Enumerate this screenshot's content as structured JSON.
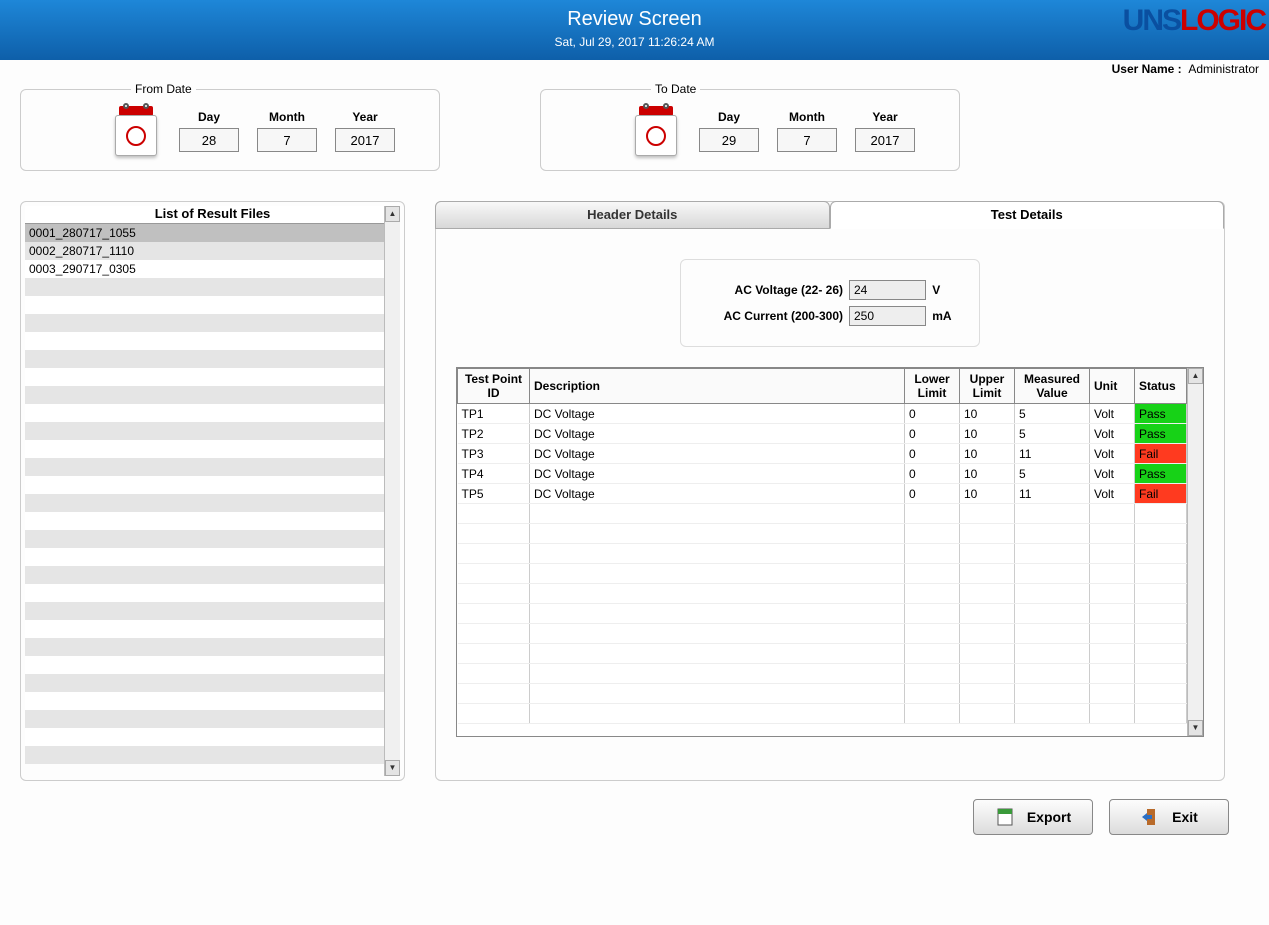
{
  "header": {
    "title": "Review Screen",
    "timestamp": "Sat, Jul 29, 2017 11:26:24 AM",
    "logo_text_blue": "UNS",
    "logo_text_red": "LOGIC"
  },
  "user_bar": {
    "label": "User Name :",
    "user_name": "Administrator"
  },
  "from_date": {
    "legend": "From Date",
    "day_label": "Day",
    "month_label": "Month",
    "year_label": "Year",
    "day": "28",
    "month": "7",
    "year": "2017"
  },
  "to_date": {
    "legend": "To Date",
    "day_label": "Day",
    "month_label": "Month",
    "year_label": "Year",
    "day": "29",
    "month": "7",
    "year": "2017"
  },
  "file_list": {
    "title": "List of Result Files",
    "items": [
      "0001_280717_1055",
      "0002_280717_1110",
      "0003_290717_0305"
    ],
    "selected_index": 0
  },
  "tabs": {
    "header_details": "Header Details",
    "test_details": "Test Details",
    "active": "test_details"
  },
  "ac": {
    "voltage_label": "AC Voltage (22- 26)",
    "voltage_value": "24",
    "voltage_unit": "V",
    "current_label": "AC Current (200-300)",
    "current_value": "250",
    "current_unit": "mA"
  },
  "grid": {
    "columns": {
      "tp_id": "Test Point ID",
      "desc": "Description",
      "low": "Lower Limit",
      "up": "Upper Limit",
      "meas": "Measured Value",
      "unit": "Unit",
      "status": "Status"
    },
    "rows": [
      {
        "tp_id": "TP1",
        "desc": "DC Voltage",
        "low": "0",
        "up": "10",
        "meas": "5",
        "unit": "Volt",
        "status": "Pass"
      },
      {
        "tp_id": "TP2",
        "desc": "DC Voltage",
        "low": "0",
        "up": "10",
        "meas": "5",
        "unit": "Volt",
        "status": "Pass"
      },
      {
        "tp_id": "TP3",
        "desc": "DC Voltage",
        "low": "0",
        "up": "10",
        "meas": "11",
        "unit": "Volt",
        "status": "Fail"
      },
      {
        "tp_id": "TP4",
        "desc": "DC Voltage",
        "low": "0",
        "up": "10",
        "meas": "5",
        "unit": "Volt",
        "status": "Pass"
      },
      {
        "tp_id": "TP5",
        "desc": "DC Voltage",
        "low": "0",
        "up": "10",
        "meas": "11",
        "unit": "Volt",
        "status": "Fail"
      }
    ]
  },
  "buttons": {
    "export": "Export",
    "exit": "Exit"
  }
}
